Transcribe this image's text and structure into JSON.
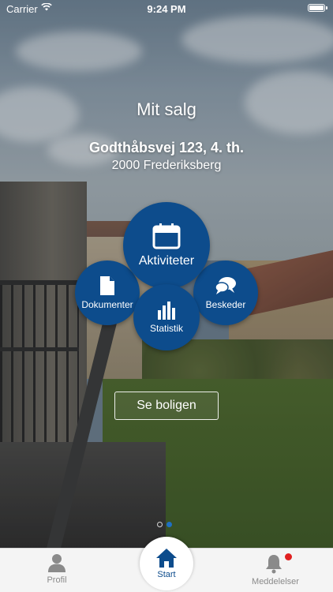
{
  "status_bar": {
    "carrier": "Carrier",
    "time": "9:24 PM"
  },
  "page": {
    "title": "Mit salg",
    "address_line1": "Godthåbsvej 123, 4. th.",
    "address_line2": "2000 Frederiksberg"
  },
  "menu": {
    "aktiviteter": "Aktiviteter",
    "dokumenter": "Dokumenter",
    "beskeder": "Beskeder",
    "statistik": "Statistik"
  },
  "se_boligen_label": "Se boligen",
  "pager": {
    "count": 2,
    "active": 2
  },
  "tabbar": {
    "profil": "Profil",
    "start": "Start",
    "meddelelser": "Meddelelser"
  },
  "colors": {
    "accent": "#0d4c8c",
    "badge": "#e02020"
  }
}
